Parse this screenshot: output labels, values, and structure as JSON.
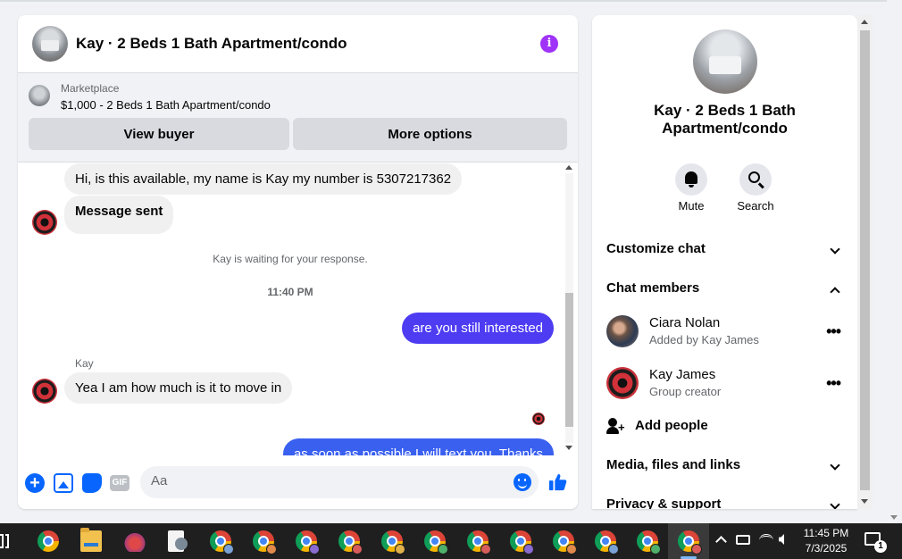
{
  "chat": {
    "title": "Kay · 2 Beds 1 Bath Apartment/condo",
    "marketplace": {
      "label": "Marketplace",
      "listing": "$1,000 - 2 Beds 1 Bath Apartment/condo",
      "view_buyer": "View buyer",
      "more_options": "More options"
    },
    "messages": [
      {
        "from": "Kay",
        "dir": "in",
        "text": "Hi, is this available, my name is Kay my number is 5307217362"
      },
      {
        "from": "Kay",
        "dir": "in",
        "text": "Message sent"
      }
    ],
    "waiting_notice": "Kay is waiting for your response.",
    "timestamp": "11:40 PM",
    "reply_1": "are you still interested",
    "sender_label": "Kay",
    "reply_in": "Yea I am how much is it to move in",
    "reply_2": "as soon as possible I will text you. Thanks",
    "composer": {
      "placeholder": "Aa",
      "gif_label": "GIF"
    }
  },
  "info_panel": {
    "name": "Kay · 2 Beds 1 Bath Apartment/condo",
    "controls": [
      {
        "label": "Mute",
        "icon": "bell-icon"
      },
      {
        "label": "Search",
        "icon": "search-icon"
      }
    ],
    "sections": {
      "customize": "Customize chat",
      "members": "Chat members",
      "media": "Media, files and links",
      "privacy": "Privacy & support"
    },
    "members": [
      {
        "name": "Ciara Nolan",
        "sub": "Added by Kay James"
      },
      {
        "name": "Kay James",
        "sub": "Group creator"
      }
    ],
    "add_people": "Add people",
    "more_glyph": "•••"
  },
  "taskbar": {
    "time": "11:45 PM",
    "date": "7/3/2025",
    "notification_count": "1",
    "badge_colors": [
      "#7aa2d6",
      "#e0894a",
      "#8a6bd1",
      "#d95c5c",
      "#e0b14a",
      "#4fb06b"
    ]
  },
  "colors": {
    "accent": "#0866ff",
    "info_purple": "#a033f8",
    "outgoing_bubble": "#4e3cf3"
  }
}
